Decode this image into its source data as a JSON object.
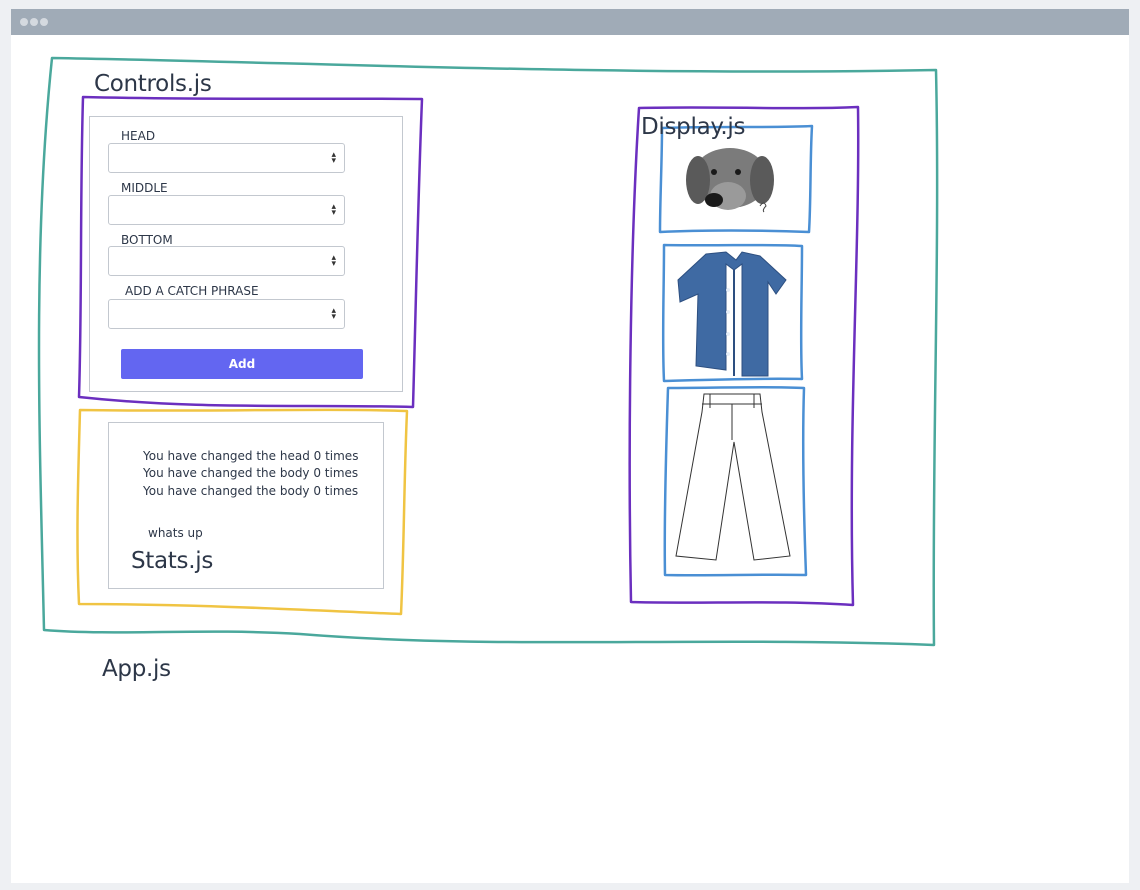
{
  "labels": {
    "controls": "Controls.js",
    "display": "Display.js",
    "stats": "Stats.js",
    "app": "App.js"
  },
  "controls": {
    "fields": [
      {
        "label": "HEAD",
        "value": ""
      },
      {
        "label": "MIDDLE",
        "value": ""
      },
      {
        "label": "BOTTOM",
        "value": ""
      },
      {
        "label": "ADD A CATCH PHRASE",
        "value": ""
      }
    ],
    "add_button": "Add"
  },
  "stats": {
    "lines": [
      "You have changed the head 0 times",
      "You have changed the body 0 times",
      "You have changed the body 0 times"
    ],
    "catch_phrase": "whats up"
  },
  "display": {
    "images": [
      "dog-head-icon",
      "blue-shirt-icon",
      "white-pants-icon"
    ]
  },
  "colors": {
    "app_outline": "#4aa89c",
    "controls_outline": "#6b2fbf",
    "stats_outline": "#f0c443",
    "display_outline": "#6b2fbf",
    "image_outline": "#4a8fd4",
    "button": "#6366f1"
  }
}
